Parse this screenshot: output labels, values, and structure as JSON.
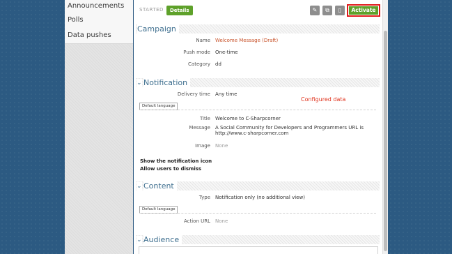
{
  "sidebar": {
    "items": [
      {
        "label": "Announcements"
      },
      {
        "label": "Polls"
      },
      {
        "label": "Data pushes"
      }
    ]
  },
  "toolbar": {
    "status": "STARTED",
    "details_label": "Details",
    "activate_label": "Activate",
    "tools": [
      "edit-icon",
      "copy-icon",
      "delete-icon"
    ]
  },
  "campaign": {
    "title": "Campaign",
    "name_label": "Name",
    "name_value": "Welcome Message (Draft)",
    "push_mode_label": "Push mode",
    "push_mode_value": "One-time",
    "category_label": "Category",
    "category_value": "dd"
  },
  "notification": {
    "title": "Notification",
    "delivery_label": "Delivery time",
    "delivery_value": "Any time",
    "configured_note": "Configured data",
    "language_tag": "Default language",
    "title_label": "Title",
    "title_value": "Welcome to C-Sharpcorner",
    "message_label": "Message",
    "message_line1": "A Social Community for Developers and Programmers URL is",
    "message_line2": "http://www.c-sharpcorner.com",
    "image_label": "Image",
    "image_value": "None",
    "show_icon": "Show the notification icon",
    "allow_dismiss": "Allow users to dismiss"
  },
  "content": {
    "title": "Content",
    "type_label": "Type",
    "type_value": "Notification only (no additional view)",
    "language_tag": "Default language",
    "action_url_label": "Action URL",
    "action_url_value": "None"
  },
  "audience": {
    "title": "Audience"
  },
  "colors": {
    "accent_green": "#5ea12a",
    "section_blue": "#3f6f8f",
    "name_orange": "#c8522a",
    "highlight_red": "#e01a1a",
    "background": "#2c5a82"
  }
}
